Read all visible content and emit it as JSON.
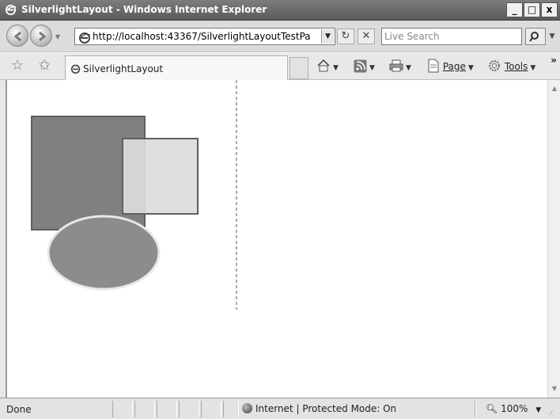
{
  "window": {
    "title": "SilverlightLayout - Windows Internet Explorer",
    "minimize": "_",
    "maximize": "□",
    "close": "x"
  },
  "addressbar": {
    "url": "http://localhost:43367/SilverlightLayoutTestPa"
  },
  "search": {
    "placeholder": "Live Search"
  },
  "tab": {
    "label": "SilverlightLayout"
  },
  "commands": {
    "page": "Page",
    "tools": "Tools"
  },
  "statusbar": {
    "status": "Done",
    "zone": "Internet | Protected Mode: On",
    "zoom": "100%"
  },
  "colors": {
    "rect_dark": "#808080",
    "rect_light": "#dcdcdc",
    "ellipse": "#8c8c8c"
  },
  "icons": [
    "ie-logo-icon",
    "back-icon",
    "forward-icon",
    "refresh-icon",
    "stop-icon",
    "search-icon",
    "favorites-star-icon",
    "add-favorites-icon",
    "home-icon",
    "feeds-icon",
    "print-icon",
    "page-icon",
    "tools-gear-icon",
    "globe-icon",
    "zoom-icon"
  ]
}
